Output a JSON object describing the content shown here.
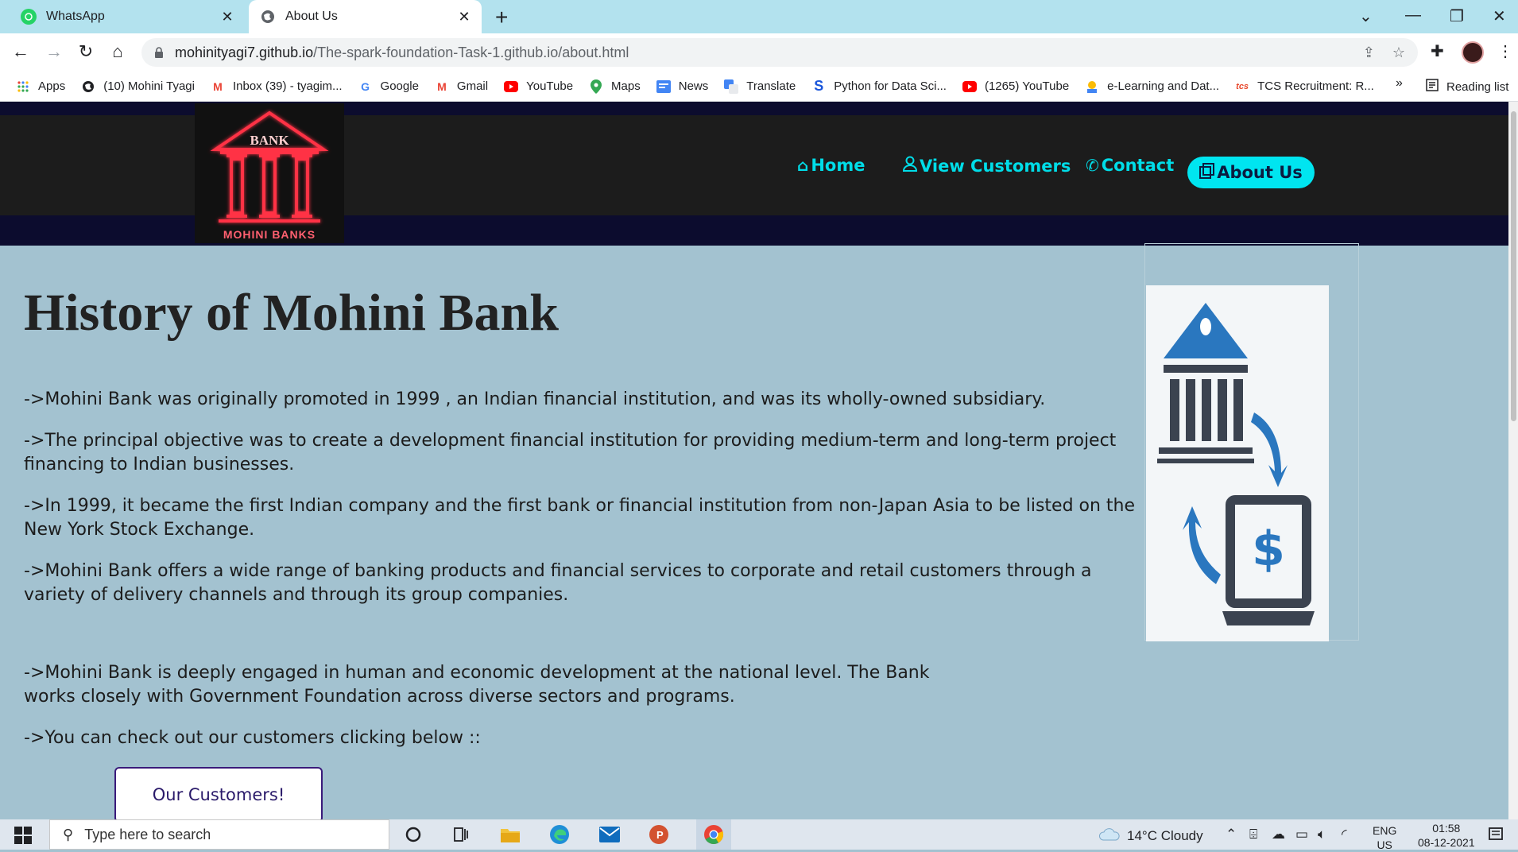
{
  "browser": {
    "tabs": [
      {
        "title": "WhatsApp",
        "icon": "whatsapp-icon"
      },
      {
        "title": "About Us",
        "icon": "globe-icon"
      }
    ],
    "url_host": "mohinityagi7.github.io",
    "url_path": "/The-spark-foundation-Task-1.github.io/about.html",
    "bookmarks": [
      {
        "label": "Apps",
        "icon": "apps-grid-icon"
      },
      {
        "label": "(10) Mohini Tyagi",
        "icon": "globe-icon"
      },
      {
        "label": "Inbox (39) - tyagim...",
        "icon": "gmail-icon"
      },
      {
        "label": "Google",
        "icon": "google-icon"
      },
      {
        "label": "Gmail",
        "icon": "gmail-icon"
      },
      {
        "label": "YouTube",
        "icon": "youtube-icon"
      },
      {
        "label": "Maps",
        "icon": "maps-pin-icon"
      },
      {
        "label": "News",
        "icon": "news-icon"
      },
      {
        "label": "Translate",
        "icon": "translate-icon"
      },
      {
        "label": "Python for Data Sci...",
        "icon": "s-logo-icon"
      },
      {
        "label": "(1265) YouTube",
        "icon": "youtube-icon"
      },
      {
        "label": "e-Learning and Dat...",
        "icon": "elearning-icon"
      },
      {
        "label": "TCS Recruitment: R...",
        "icon": "tcs-icon"
      }
    ],
    "more_bookmarks": "»",
    "reading_list": "Reading list"
  },
  "site": {
    "logo_top": "BANK",
    "logo_bottom": "MOHINI BANKS",
    "nav": {
      "home": "Home",
      "customers": "View Customers",
      "contact": "Contact",
      "about": "About Us"
    },
    "heading": "History of Mohini Bank",
    "paragraphs": [
      "->Mohini Bank was originally promoted in 1999 , an Indian financial institution, and was its wholly-owned subsidiary.",
      "->The principal objective was to create a development financial institution for providing medium-term and long-term project financing to Indian businesses.",
      "->In 1999, it became the first Indian company and the first bank or financial institution from non-Japan Asia to be listed on the New York Stock Exchange.",
      "->Mohini Bank offers a wide range of banking products and financial services to corporate and retail customers through a variety of delivery channels and through its group companies.",
      "->Mohini Bank is deeply engaged in human and economic development at the national level. The Bank works closely with Government Foundation across diverse sectors and programs.",
      "->You can check out our customers clicking below ::"
    ],
    "customers_button": "Our Customers!",
    "accent_color": "#00e5f0"
  },
  "taskbar": {
    "search_placeholder": "Type here to search",
    "weather": "14°C  Cloudy",
    "language_line1": "ENG",
    "language_line2": "US",
    "time": "01:58",
    "date": "08-12-2021"
  }
}
